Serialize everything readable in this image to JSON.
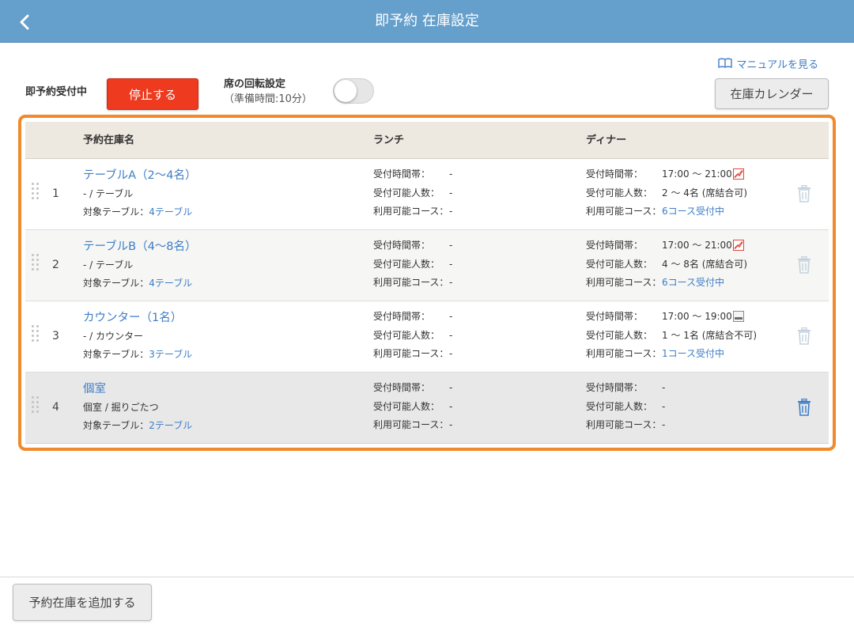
{
  "header": {
    "title": "即予約 在庫設定",
    "back_icon": "chevron-left-icon"
  },
  "manual_link": {
    "label": "マニュアルを見る",
    "icon": "book-icon"
  },
  "status": {
    "label": "即予約受付中",
    "stop_button": "停止する"
  },
  "rotation": {
    "title": "席の回転設定",
    "subtitle": "（準備時間:10分）",
    "toggle_on": false
  },
  "calendar_button": "在庫カレンダー",
  "table": {
    "headers": {
      "name": "予約在庫名",
      "lunch": "ランチ",
      "dinner": "ディナー"
    },
    "field_labels": {
      "time": "受付時間帯：",
      "people": "受付可能人数：",
      "course": "利用可能コース：",
      "target": "対象テーブル："
    },
    "rows": [
      {
        "index": "1",
        "name": "テーブルA（2〜4名）",
        "type": "- / テーブル",
        "target": "4テーブル",
        "lunch": {
          "time": "-",
          "people": "-",
          "course": "-"
        },
        "dinner": {
          "time": "17:00 〜 21:00",
          "people": "2 〜 4名 (席結合可)",
          "course": "6コース受付中",
          "time_icon": "red-chart-icon"
        },
        "trash_enabled": false
      },
      {
        "index": "2",
        "name": "テーブルB（4〜8名）",
        "type": "- / テーブル",
        "target": "4テーブル",
        "lunch": {
          "time": "-",
          "people": "-",
          "course": "-"
        },
        "dinner": {
          "time": "17:00 〜 21:00",
          "people": "4 〜 8名 (席結合可)",
          "course": "6コース受付中",
          "time_icon": "red-chart-icon"
        },
        "trash_enabled": false
      },
      {
        "index": "3",
        "name": "カウンター（1名）",
        "type": "- / カウンター",
        "target": "3テーブル",
        "lunch": {
          "time": "-",
          "people": "-",
          "course": "-"
        },
        "dinner": {
          "time": "17:00 〜 19:00",
          "people": "1 〜 1名 (席結合不可)",
          "course": "1コース受付中",
          "time_icon": "grey-chart-icon"
        },
        "trash_enabled": false
      },
      {
        "index": "4",
        "name": "個室",
        "type": "個室 / 掘りごたつ",
        "target": "2テーブル",
        "lunch": {
          "time": "-",
          "people": "-",
          "course": "-"
        },
        "dinner": {
          "time": "-",
          "people": "-",
          "course": "-",
          "time_icon": ""
        },
        "trash_enabled": true
      }
    ]
  },
  "add_button": "予約在庫を追加する",
  "colors": {
    "header_bg": "#659fcc",
    "stop_red": "#ee3a1f",
    "frame_orange": "#f08a2c",
    "link_blue": "#3d7dc6",
    "trash_active": "#3d7dc6",
    "trash_disabled": "#c5d2de"
  }
}
